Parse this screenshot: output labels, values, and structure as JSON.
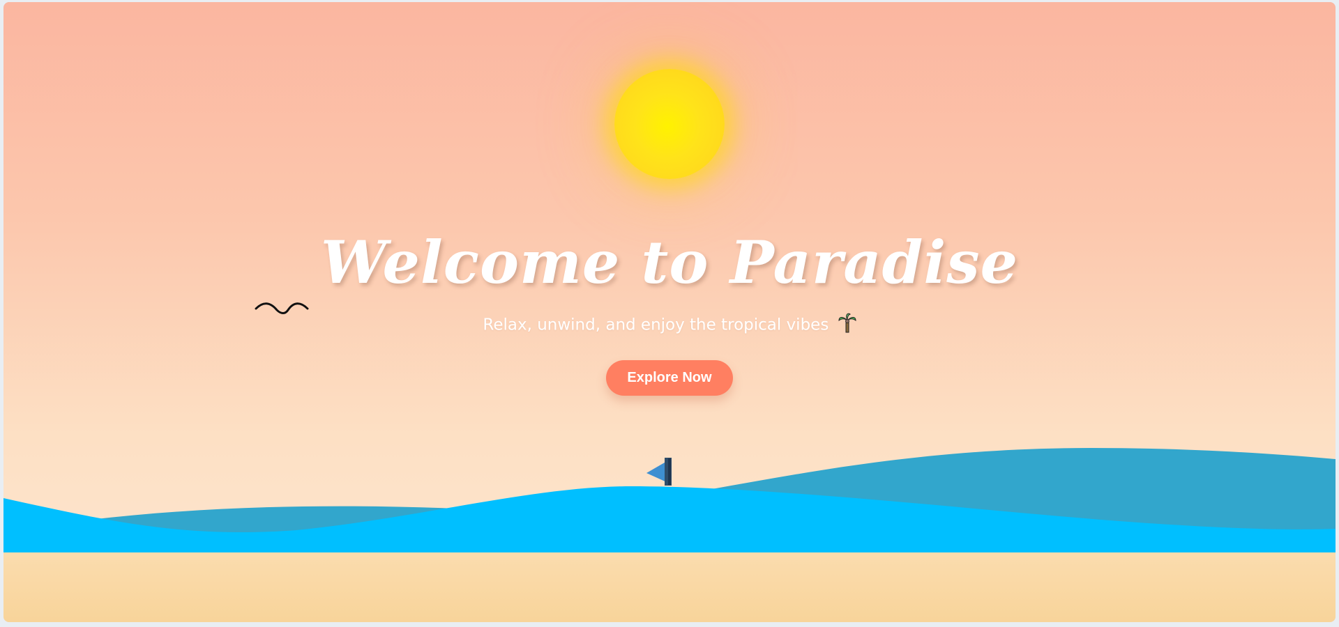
{
  "hero": {
    "title": "Welcome to Paradise",
    "subtitle": "Relax, unwind, and enjoy the tropical vibes",
    "cta_label": "Explore Now"
  },
  "icons": {
    "sun": "sun-icon",
    "bird": "bird-icon",
    "boat": "sailboat-icon",
    "palm": "palm-tree-icon"
  },
  "colors": {
    "sky_top": "#fbb6a0",
    "sky_bottom": "#fde6d1",
    "sun": "#ffd11f",
    "button": "#ff7f61",
    "wave_back": "#32a6cc",
    "wave_front": "#00bfff",
    "sand_top": "#fbdcae",
    "sand_bottom": "#f8d49a"
  }
}
